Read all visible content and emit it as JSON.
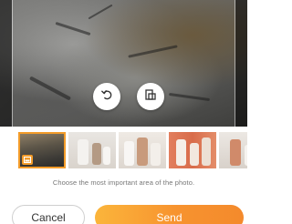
{
  "editor": {
    "rotate_icon": "rotate-left-icon",
    "aspect_icon": "aspect-ratio-icon"
  },
  "thumbnails": [
    {
      "name": "rock-landscape",
      "selected": true,
      "badge_icon": "image-badge-icon"
    },
    {
      "name": "people-photo-1",
      "selected": false
    },
    {
      "name": "people-photo-2",
      "selected": false
    },
    {
      "name": "people-photo-3",
      "selected": false
    },
    {
      "name": "people-photo-4",
      "selected": false
    }
  ],
  "hint_text": "Choose the most important area of the photo.",
  "actions": {
    "cancel_label": "Cancel",
    "send_label": "Send"
  },
  "colors": {
    "accent": "#f39c2a",
    "send_gradient_start": "#fbb53b",
    "send_gradient_end": "#f48a2c"
  }
}
